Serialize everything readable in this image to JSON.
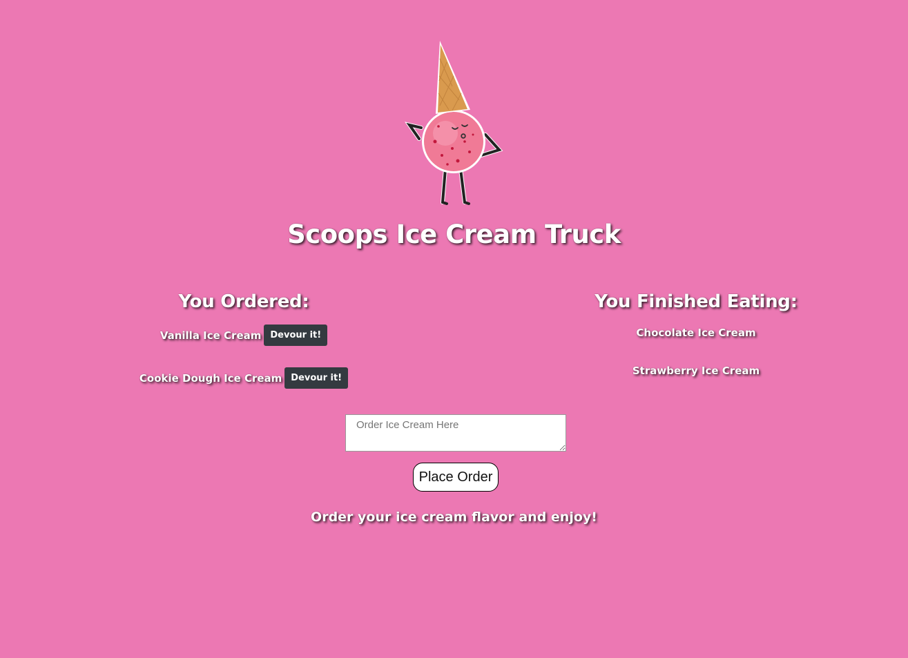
{
  "header": {
    "mascot_icon": "ice-cream-cone-mascot-icon",
    "title": "Scoops Ice Cream Truck"
  },
  "ordered": {
    "heading": "You Ordered:",
    "items": [
      {
        "label": "Vanilla Ice Cream",
        "button": "Devour it!"
      },
      {
        "label": "Cookie Dough Ice Cream",
        "button": "Devour it!"
      }
    ]
  },
  "finished": {
    "heading": "You Finished Eating:",
    "items": [
      {
        "label": "Chocolate Ice Cream"
      },
      {
        "label": "Strawberry Ice Cream"
      }
    ]
  },
  "order_form": {
    "placeholder": "Order Ice Cream Here",
    "value": "",
    "submit_label": "Place Order"
  },
  "footer": {
    "tagline": "Order your ice cream flavor and enjoy!"
  },
  "colors": {
    "background": "#ec78b3",
    "button_dark": "#343a40",
    "text": "#ffffff"
  }
}
